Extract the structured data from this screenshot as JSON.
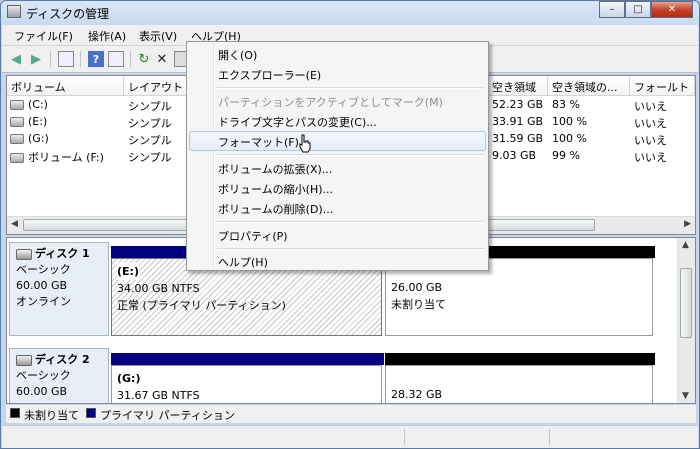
{
  "window": {
    "title": "ディスクの管理",
    "minimize": "–",
    "maximize": "□",
    "close": "✕"
  },
  "menubar": {
    "file": "ファイル(F)",
    "action": "操作(A)",
    "view": "表示(V)",
    "help": "ヘルプ(H)"
  },
  "toolbar": {
    "back": "◀",
    "forward": "▶",
    "refresh": "↻",
    "delete": "✕",
    "help": "?"
  },
  "volume_list": {
    "columns": [
      "ボリューム",
      "レイアウト",
      "空き領域",
      "空き領域の...",
      "フォールト"
    ],
    "rows": [
      {
        "volume": "(C:)",
        "layout": "シンプル",
        "free": "52.23 GB",
        "pct": "83 %",
        "fault": "いいえ"
      },
      {
        "volume": "(E:)",
        "layout": "シンプル",
        "free": "33.91 GB",
        "pct": "100 %",
        "fault": "いいえ"
      },
      {
        "volume": "(G:)",
        "layout": "シンプル",
        "free": "31.59 GB",
        "pct": "100 %",
        "fault": "いいえ"
      },
      {
        "volume": "ボリューム (F:)",
        "layout": "シンプル",
        "free": "9.03 GB",
        "pct": "99 %",
        "fault": "いいえ"
      }
    ]
  },
  "disks": [
    {
      "name": "ディスク 1",
      "type": "ベーシック",
      "size": "60.00 GB",
      "status": "オンライン",
      "partition": {
        "label": "(E:)",
        "size": "34.00 GB NTFS",
        "status": "正常 (プライマリ パーティション)"
      },
      "unallocated": {
        "size": "26.00 GB",
        "status": "未割り当て"
      }
    },
    {
      "name": "ディスク 2",
      "type": "ベーシック",
      "size": "60.00 GB",
      "partition": {
        "label": "(G:)",
        "size": "31.67 GB NTFS"
      },
      "unallocated": {
        "size": "28.32 GB"
      }
    }
  ],
  "legend": {
    "unallocated": "未割り当て",
    "primary": "プライマリ パーティション"
  },
  "context_menu": {
    "open": "開く(O)",
    "explore": "エクスプローラー(E)",
    "mark_active": "パーティションをアクティブとしてマーク(M)",
    "change_letter": "ドライブ文字とパスの変更(C)...",
    "format": "フォーマット(F)...",
    "extend": "ボリュームの拡張(X)...",
    "shrink": "ボリュームの縮小(H)...",
    "delete": "ボリュームの削除(D)...",
    "properties": "プロパティ(P)",
    "help": "ヘルプ(H)"
  },
  "colors": {
    "primary_partition": "#000080",
    "unallocated": "#000000",
    "menu_hover": "#a8c8ec"
  }
}
